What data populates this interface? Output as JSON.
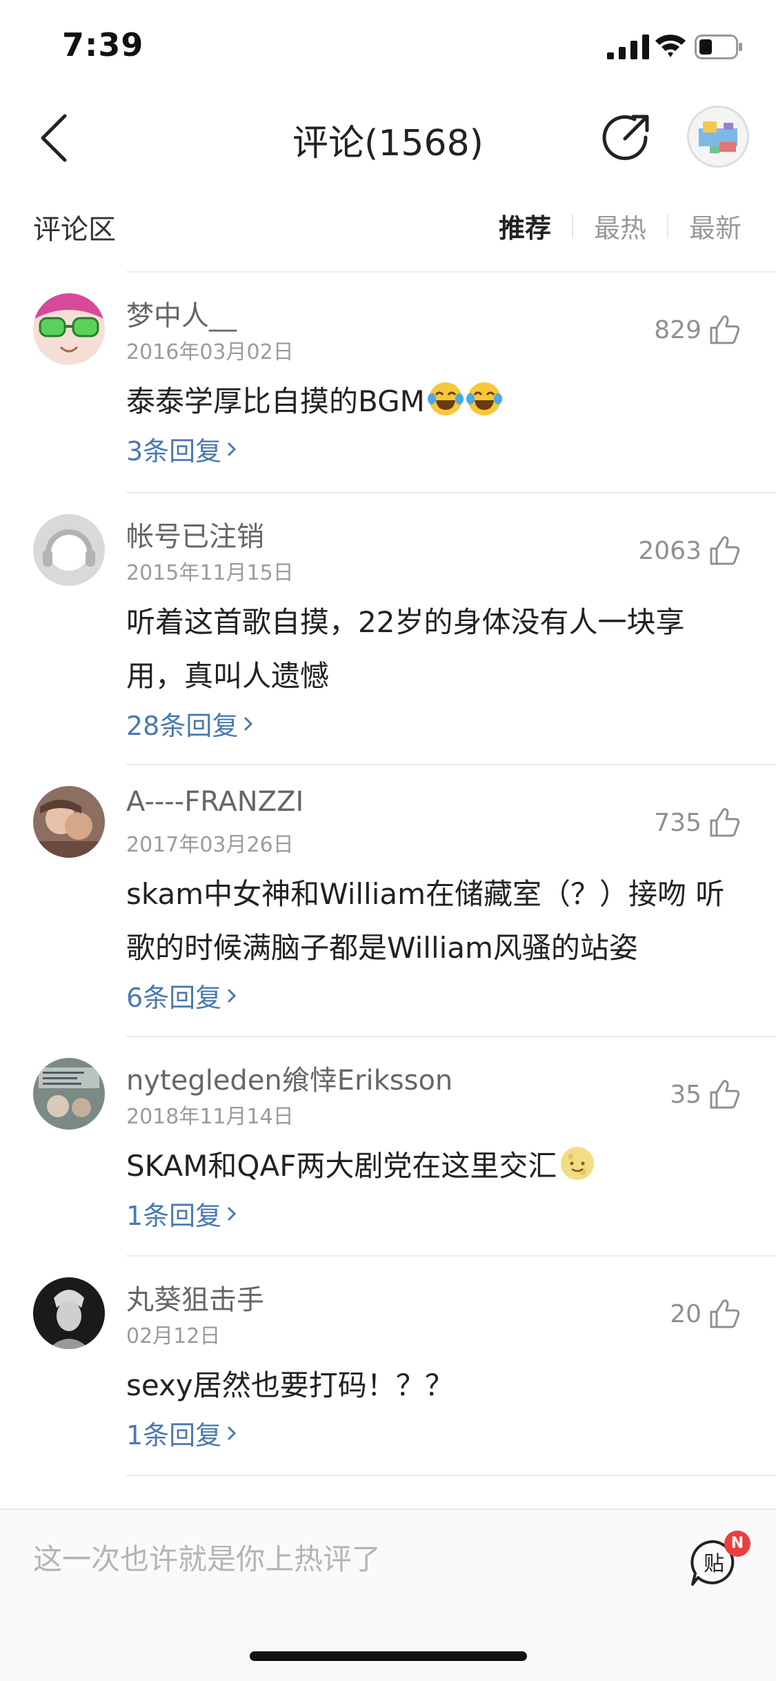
{
  "status_bar": {
    "time": "7:39"
  },
  "nav": {
    "title": "评论(1568)"
  },
  "section": {
    "title": "评论区",
    "tabs": [
      {
        "label": "推荐",
        "active": true
      },
      {
        "label": "最热",
        "active": false
      },
      {
        "label": "最新",
        "active": false
      }
    ]
  },
  "comments": [
    {
      "username": "梦中人__",
      "date": "2016年03月02日",
      "likes": "829",
      "text": "泰泰学厚比自摸的BGM",
      "emoji_count": 2,
      "replies": "3条回复"
    },
    {
      "username": "帐号已注销",
      "date": "2015年11月15日",
      "likes": "2063",
      "text": "听着这首歌自摸，22岁的身体没有人一块享用，真叫人遗憾",
      "replies": "28条回复"
    },
    {
      "username": "A----FRANZZI",
      "date": "2017年03月26日",
      "likes": "735",
      "text": "skam中女神和William在储藏室（？）接吻 听歌的时候满脑子都是William风骚的站姿",
      "replies": "6条回复"
    },
    {
      "username": "nytegleden飨悻Eriksson",
      "date": "2018年11月14日",
      "likes": "35",
      "text": "SKAM和QAF两大剧党在这里交汇",
      "emoji_count": 1,
      "replies": "1条回复"
    },
    {
      "username": "丸葵狙击手",
      "date": "02月12日",
      "likes": "20",
      "text": "sexy居然也要打码！？？",
      "replies": "1条回复"
    }
  ],
  "bottom": {
    "placeholder": "这一次也许就是你上热评了",
    "badge": "N",
    "post_icon_label": "贴"
  }
}
